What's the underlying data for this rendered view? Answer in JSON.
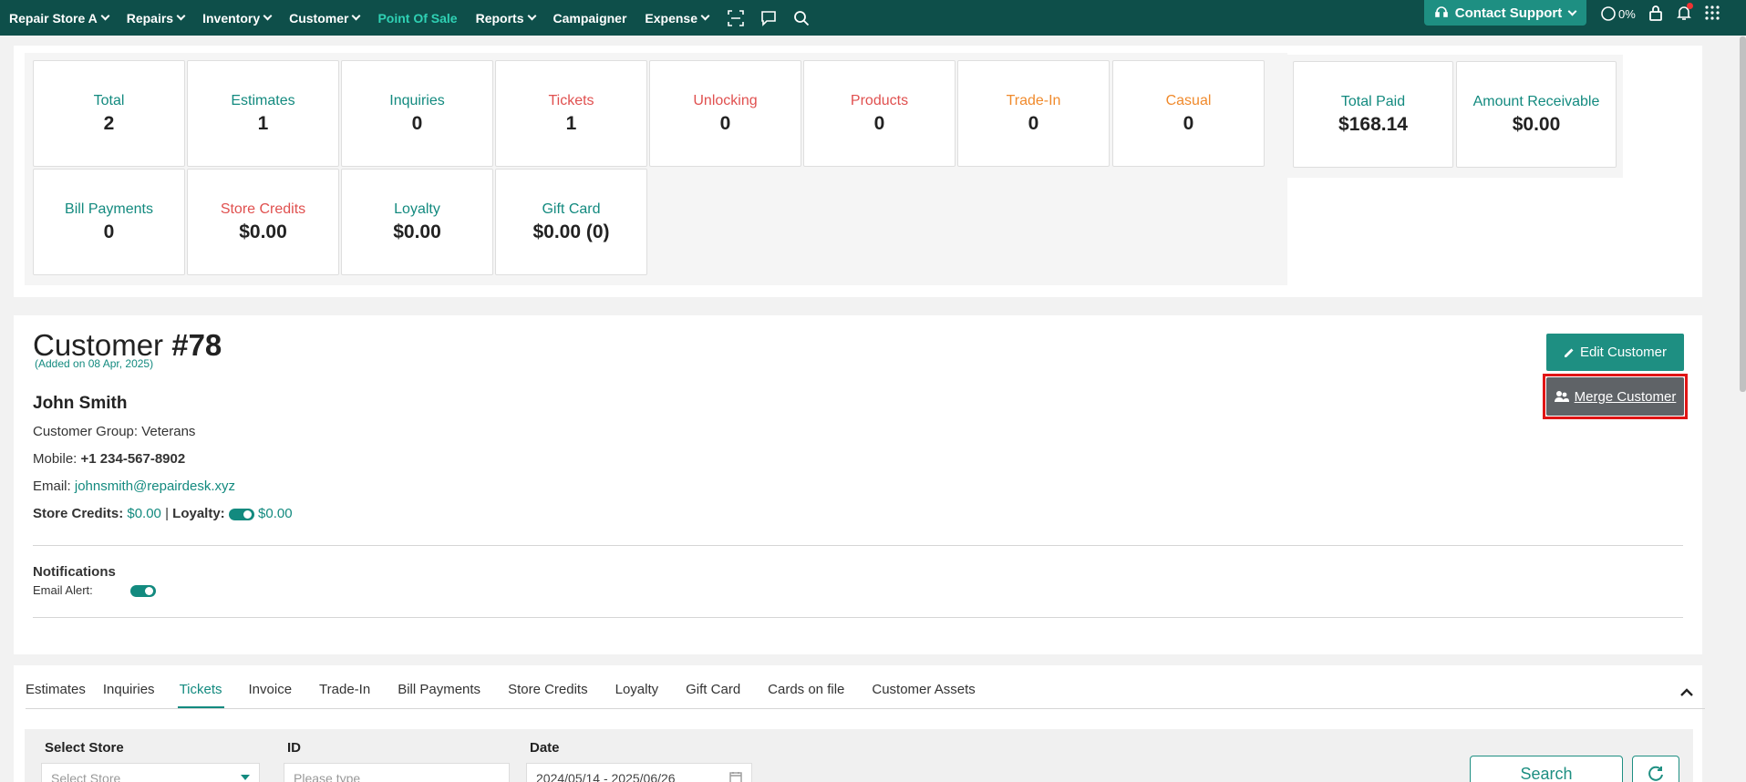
{
  "nav": {
    "store": "Repair Store A",
    "items": [
      "Repairs",
      "Inventory",
      "Customer"
    ],
    "active": "Point Of Sale",
    "items2": [
      "Reports"
    ],
    "campaigner": "Campaigner",
    "expense": "Expense",
    "contact_support": "Contact Support",
    "progress": "0%"
  },
  "stats": {
    "row1": [
      {
        "label": "Total",
        "value": "2"
      },
      {
        "label": "Estimates",
        "value": "1"
      },
      {
        "label": "Inquiries",
        "value": "0"
      },
      {
        "label": "Tickets",
        "value": "1"
      },
      {
        "label": "Unlocking",
        "value": "0"
      },
      {
        "label": "Products",
        "value": "0"
      },
      {
        "label": "Trade-In",
        "value": "0"
      },
      {
        "label": "Casual",
        "value": "0"
      }
    ],
    "row2": [
      {
        "label": "Bill Payments",
        "value": "0"
      },
      {
        "label": "Store Credits",
        "value": "$0.00"
      },
      {
        "label": "Loyalty",
        "value": "$0.00"
      },
      {
        "label": "Gift Card",
        "value": "$0.00 (0)"
      }
    ],
    "payments": [
      {
        "label": "Total Paid",
        "value": "$168.14"
      },
      {
        "label": "Amount Receivable",
        "value": "$0.00"
      }
    ]
  },
  "customer": {
    "title_prefix": "Customer",
    "number": "#78",
    "added": "(Added on 08 Apr, 2025)",
    "name": "John Smith",
    "group_label": "Customer Group:",
    "group_value": "Veterans",
    "mobile_label": "Mobile:",
    "mobile_value": "+1 234-567-8902",
    "email_label": "Email:",
    "email_value": "johnsmith@repairdesk.xyz",
    "store_credits_label": "Store Credits:",
    "store_credits_value": "$0.00",
    "loyalty_label": "Loyalty:",
    "loyalty_value": "$0.00",
    "notifications_label": "Notifications",
    "email_alert_label": "Email Alert:",
    "edit_button": "Edit Customer",
    "merge_button": "Merge Customer"
  },
  "tabs": [
    "Estimates",
    "Inquiries",
    "Tickets",
    "Invoice",
    "Trade-In",
    "Bill Payments",
    "Store Credits",
    "Loyalty",
    "Gift Card",
    "Cards on file",
    "Customer Assets"
  ],
  "active_tab": "Tickets",
  "filters": {
    "store_label": "Select Store",
    "store_placeholder": "Select Store",
    "id_label": "ID",
    "id_placeholder": "Please type",
    "date_label": "Date",
    "date_value": "2024/05/14 - 2025/06/26",
    "search_button": "Search"
  },
  "colors": {
    "nav_bg": "#0e4f4a",
    "accent": "#1e8f82",
    "teal_text": "#138a7f",
    "red_text": "#e0504f",
    "orange_text": "#f08a2c",
    "merge_bg": "#5f6367",
    "highlight": "#e01515"
  }
}
